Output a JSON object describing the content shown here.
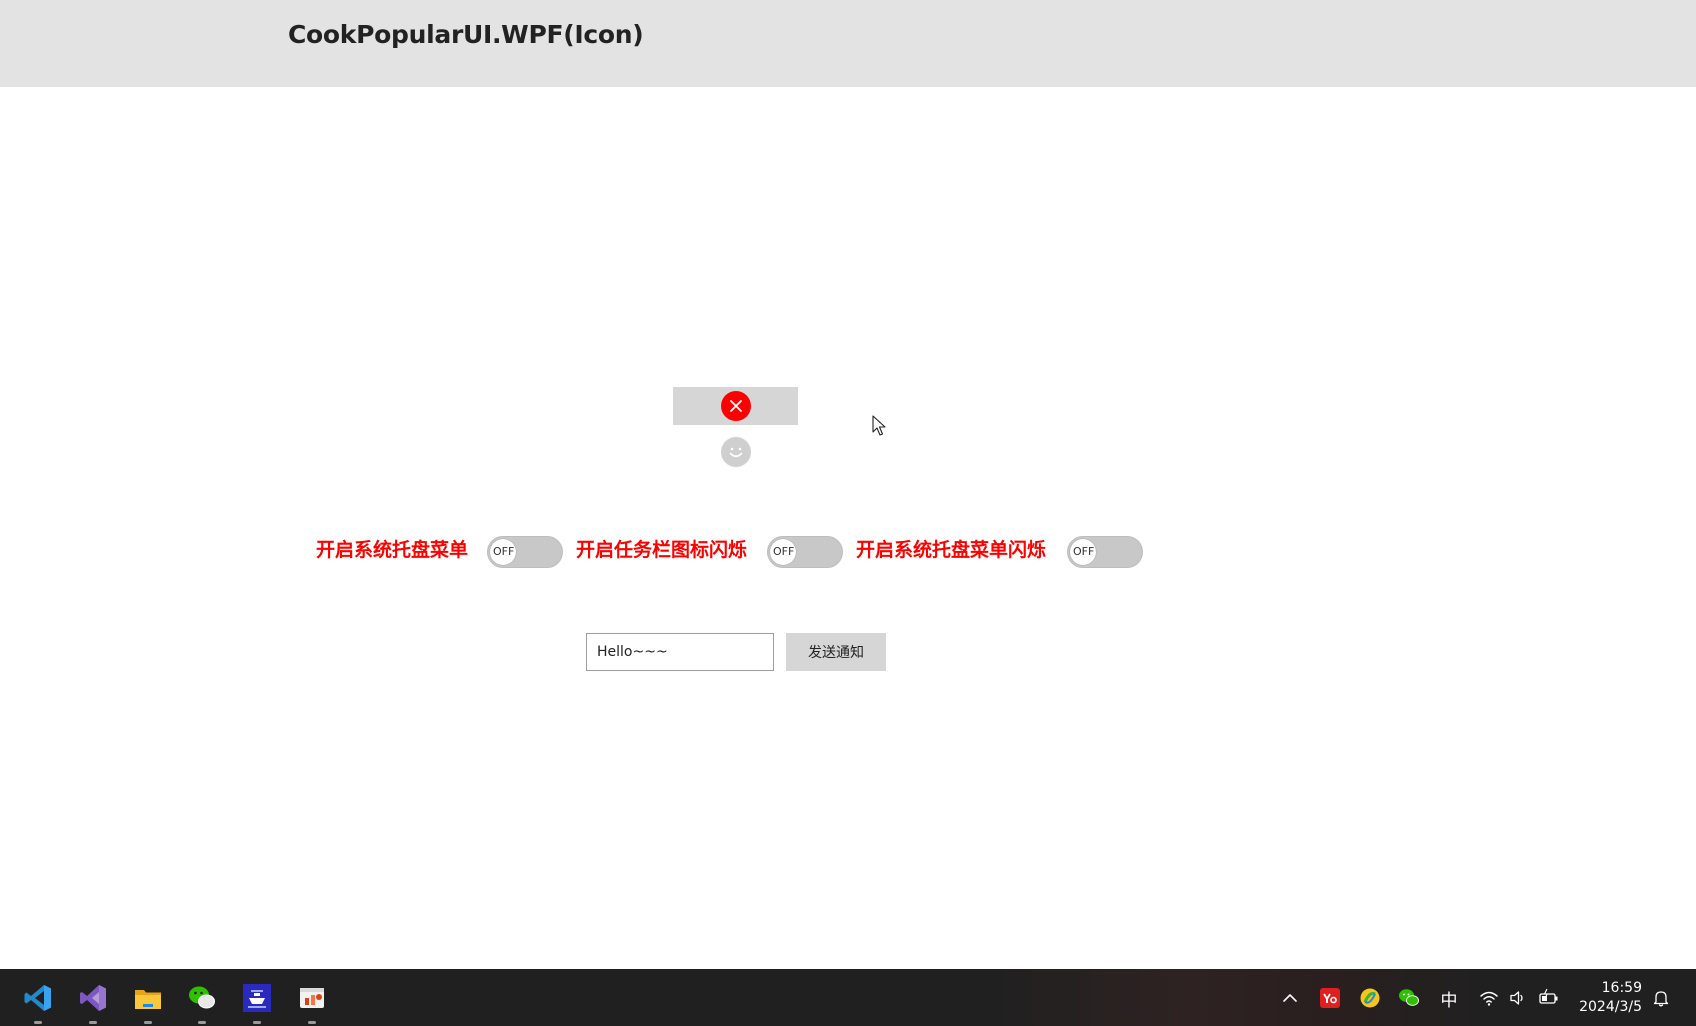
{
  "window": {
    "title": "CookPopularUI.WPF(Icon)"
  },
  "icons": {
    "close": "close-circle-icon",
    "smile": "smile-icon"
  },
  "toggles": [
    {
      "label": "开启系统托盘菜单",
      "state": "OFF"
    },
    {
      "label": "开启任务栏图标闪烁",
      "state": "OFF"
    },
    {
      "label": "开启系统托盘菜单闪烁",
      "state": "OFF"
    }
  ],
  "notification": {
    "input_value": "Hello~~~",
    "send_label": "发送通知"
  },
  "taskbar": {
    "apps": [
      "vscode-icon",
      "visual-studio-icon",
      "file-explorer-icon",
      "wechat-icon",
      "tool-icon",
      "presentation-icon"
    ],
    "tray": {
      "ime": "中",
      "time": "16:59",
      "date": "2024/3/5"
    }
  },
  "colors": {
    "accent_red": "#ff0000",
    "titlebar_bg": "#e3e3e3",
    "taskbar_bg": "#202020"
  }
}
